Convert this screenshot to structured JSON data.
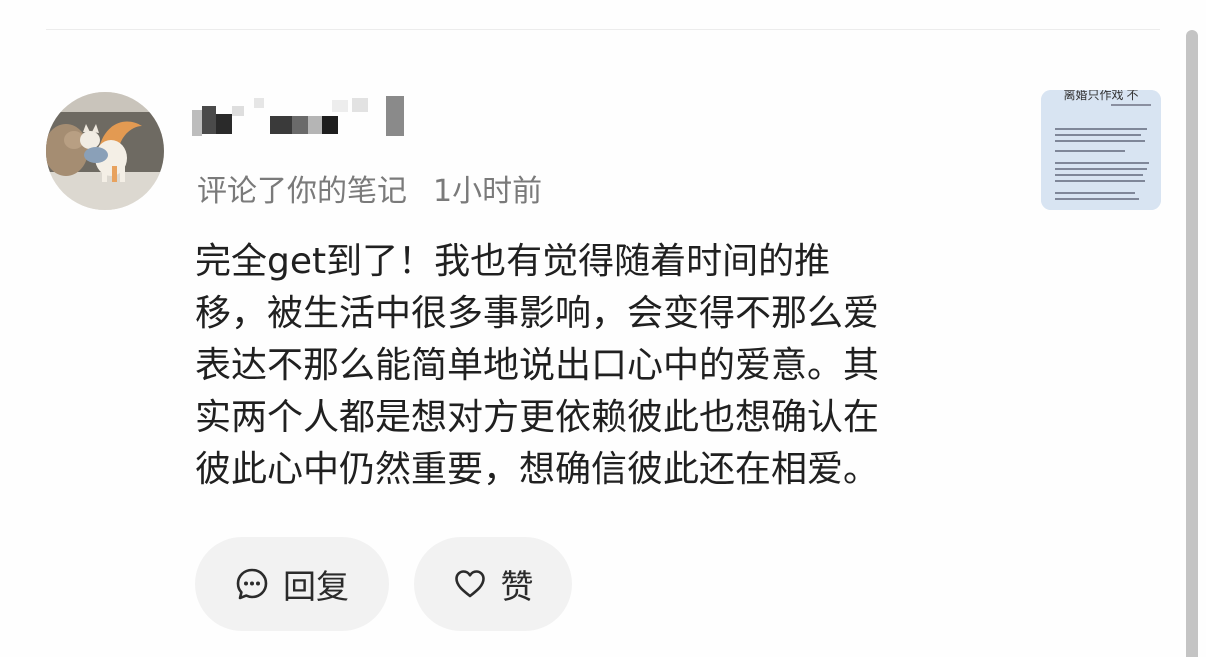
{
  "notification": {
    "username_display": "blurred",
    "action_text": "评论了你的笔记",
    "time_ago": "1小时前",
    "comment_lines": [
      "完全get到了！我也有觉得随着时间的推",
      "移，被生活中很多事影响，会变得不那么爱",
      "表达不那么能简单地说出口心中的爱意。其",
      "实两个人都是想对方更依赖彼此也想确认在",
      "彼此心中仍然重要，想确信彼此还在相爱。"
    ],
    "thumbnail_header": "离婚只作戏 不"
  },
  "actions": {
    "reply_label": "回复",
    "like_label": "赞",
    "reply_icon": "comment-bubble-icon",
    "like_icon": "heart-icon"
  },
  "colors": {
    "action_button_bg": "#f2f2f2",
    "meta_text": "#7a7a7a",
    "body_text": "#202020"
  }
}
